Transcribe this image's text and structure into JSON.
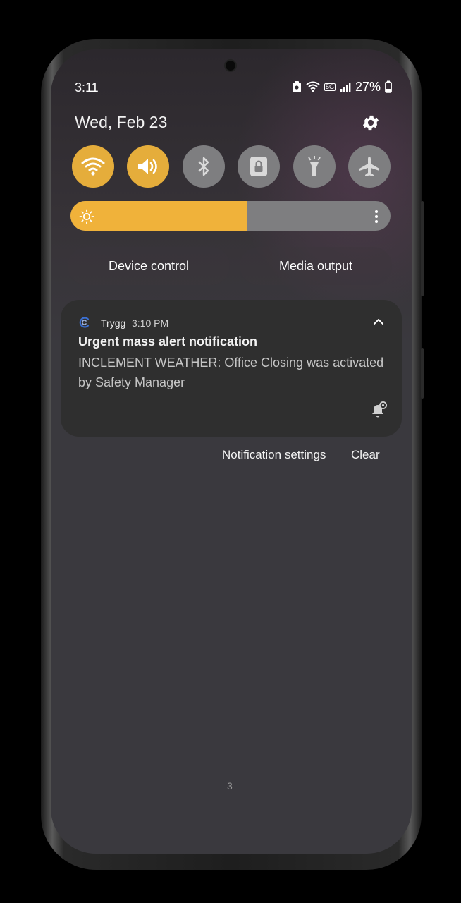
{
  "status_bar": {
    "time": "3:11",
    "battery_percent": "27%",
    "icons": [
      "data-saver-icon",
      "wifi-icon",
      "5g-icon",
      "signal-icon",
      "battery-icon"
    ],
    "network_label": "5G"
  },
  "header": {
    "date": "Wed, Feb 23",
    "settings_icon": "gear-icon"
  },
  "quick_settings": [
    {
      "name": "wifi",
      "icon": "wifi-icon",
      "state": "on"
    },
    {
      "name": "sound",
      "icon": "speaker-icon",
      "state": "on"
    },
    {
      "name": "bluetooth",
      "icon": "bluetooth-icon",
      "state": "off"
    },
    {
      "name": "screen-lock-rotation",
      "icon": "lock-icon",
      "state": "off"
    },
    {
      "name": "flashlight",
      "icon": "flashlight-icon",
      "state": "off"
    },
    {
      "name": "airplane-mode",
      "icon": "airplane-icon",
      "state": "off"
    }
  ],
  "brightness": {
    "level": 0.55,
    "icon": "sun-icon",
    "more_icon": "more-vertical-icon"
  },
  "pills": {
    "device_control": "Device control",
    "media_output": "Media output"
  },
  "notification": {
    "app_name": "Trygg",
    "time": "3:10 PM",
    "title": "Urgent mass alert notification",
    "body": "INCLEMENT WEATHER: Office Closing was activated by Safety Manager",
    "expand_icon": "chevron-up-icon",
    "alert_icon": "bell-snooze-icon"
  },
  "actions": {
    "settings_label": "Notification settings",
    "clear_label": "Clear"
  },
  "page_indicator": "3",
  "colors": {
    "toggle_on": "#e5ad3b",
    "toggle_off": "#7e7e80",
    "brightness_fill": "#f0b23a",
    "card_bg": "#2f2f2f"
  }
}
